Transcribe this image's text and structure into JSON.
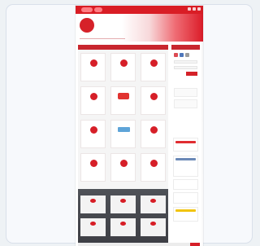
{
  "page": {
    "top_label": "",
    "brand_mark": "",
    "brand_title": "",
    "brand_subtitle": ""
  },
  "main": {
    "section_title": "",
    "tiles": [
      {
        "label": ""
      },
      {
        "label": ""
      },
      {
        "label": ""
      },
      {
        "label": ""
      },
      {
        "label": ""
      },
      {
        "label": ""
      },
      {
        "label": ""
      },
      {
        "label": ""
      },
      {
        "label": ""
      },
      {
        "label": ""
      },
      {
        "label": ""
      },
      {
        "label": ""
      }
    ],
    "dark_title": "",
    "dark_tiles": [
      {
        "label": ""
      },
      {
        "label": ""
      },
      {
        "label": ""
      },
      {
        "label": ""
      },
      {
        "label": ""
      },
      {
        "label": ""
      }
    ]
  },
  "sidebar": {
    "title": "",
    "label_1": "",
    "label_2": "",
    "ads": [
      {
        "text": ""
      },
      {
        "text": ""
      },
      {
        "text": ""
      },
      {
        "text": ""
      },
      {
        "text": ""
      }
    ]
  },
  "colors": {
    "brand_red": "#d91d25",
    "dark_red": "#c8262e",
    "slate": "#4f5258"
  }
}
